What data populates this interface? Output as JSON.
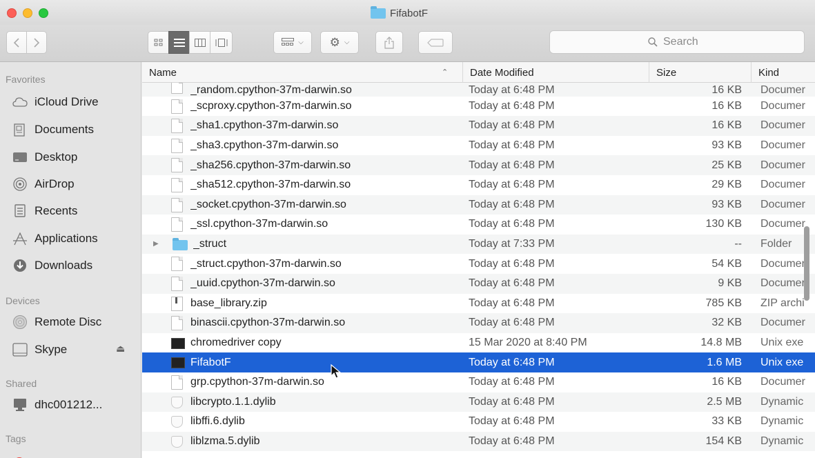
{
  "window": {
    "title": "FifabotF"
  },
  "toolbar": {
    "back_icon": "chevron-left-icon",
    "forward_icon": "chevron-right-icon",
    "view_icons": [
      "icon-view-icon",
      "list-view-icon",
      "column-view-icon",
      "gallery-view-icon"
    ],
    "active_view": "list-view-icon",
    "search_placeholder": "Search"
  },
  "sidebar": {
    "sections": {
      "favorites": "Favorites",
      "devices": "Devices",
      "shared": "Shared",
      "tags": "Tags"
    },
    "favorites": [
      {
        "label": "iCloud Drive",
        "icon": "cloud-icon"
      },
      {
        "label": "Documents",
        "icon": "documents-icon"
      },
      {
        "label": "Desktop",
        "icon": "desktop-icon"
      },
      {
        "label": "AirDrop",
        "icon": "airdrop-icon"
      },
      {
        "label": "Recents",
        "icon": "recents-icon"
      },
      {
        "label": "Applications",
        "icon": "applications-icon"
      },
      {
        "label": "Downloads",
        "icon": "downloads-icon"
      }
    ],
    "devices": [
      {
        "label": "Remote Disc",
        "icon": "disc-icon"
      },
      {
        "label": "Skype",
        "icon": "drive-icon"
      }
    ],
    "shared": [
      {
        "label": "dhc001212...",
        "icon": "computer-icon"
      }
    ]
  },
  "columns": {
    "name": "Name",
    "date": "Date Modified",
    "size": "Size",
    "kind": "Kind"
  },
  "files": [
    {
      "name": "_random.cpython-37m-darwin.so",
      "date": "Today at 6:48 PM",
      "size": "16 KB",
      "kind": "Documer",
      "icon": "doc"
    },
    {
      "name": "_scproxy.cpython-37m-darwin.so",
      "date": "Today at 6:48 PM",
      "size": "16 KB",
      "kind": "Documer",
      "icon": "doc"
    },
    {
      "name": "_sha1.cpython-37m-darwin.so",
      "date": "Today at 6:48 PM",
      "size": "16 KB",
      "kind": "Documer",
      "icon": "doc"
    },
    {
      "name": "_sha3.cpython-37m-darwin.so",
      "date": "Today at 6:48 PM",
      "size": "93 KB",
      "kind": "Documer",
      "icon": "doc"
    },
    {
      "name": "_sha256.cpython-37m-darwin.so",
      "date": "Today at 6:48 PM",
      "size": "25 KB",
      "kind": "Documer",
      "icon": "doc"
    },
    {
      "name": "_sha512.cpython-37m-darwin.so",
      "date": "Today at 6:48 PM",
      "size": "29 KB",
      "kind": "Documer",
      "icon": "doc"
    },
    {
      "name": "_socket.cpython-37m-darwin.so",
      "date": "Today at 6:48 PM",
      "size": "93 KB",
      "kind": "Documer",
      "icon": "doc"
    },
    {
      "name": "_ssl.cpython-37m-darwin.so",
      "date": "Today at 6:48 PM",
      "size": "130 KB",
      "kind": "Documer",
      "icon": "doc"
    },
    {
      "name": "_struct",
      "date": "Today at 7:33 PM",
      "size": "--",
      "kind": "Folder",
      "icon": "folder"
    },
    {
      "name": "_struct.cpython-37m-darwin.so",
      "date": "Today at 6:48 PM",
      "size": "54 KB",
      "kind": "Documer",
      "icon": "doc"
    },
    {
      "name": "_uuid.cpython-37m-darwin.so",
      "date": "Today at 6:48 PM",
      "size": "9 KB",
      "kind": "Documer",
      "icon": "doc"
    },
    {
      "name": "base_library.zip",
      "date": "Today at 6:48 PM",
      "size": "785 KB",
      "kind": "ZIP archi",
      "icon": "zip"
    },
    {
      "name": "binascii.cpython-37m-darwin.so",
      "date": "Today at 6:48 PM",
      "size": "32 KB",
      "kind": "Documer",
      "icon": "doc"
    },
    {
      "name": "chromedriver copy",
      "date": "15 Mar 2020 at 8:40 PM",
      "size": "14.8 MB",
      "kind": "Unix exe",
      "icon": "exec"
    },
    {
      "name": "FifabotF",
      "date": "Today at 6:48 PM",
      "size": "1.6 MB",
      "kind": "Unix exe",
      "icon": "exec",
      "selected": true
    },
    {
      "name": "grp.cpython-37m-darwin.so",
      "date": "Today at 6:48 PM",
      "size": "16 KB",
      "kind": "Documer",
      "icon": "doc"
    },
    {
      "name": "libcrypto.1.1.dylib",
      "date": "Today at 6:48 PM",
      "size": "2.5 MB",
      "kind": "Dynamic",
      "icon": "dylib"
    },
    {
      "name": "libffi.6.dylib",
      "date": "Today at 6:48 PM",
      "size": "33 KB",
      "kind": "Dynamic",
      "icon": "dylib"
    },
    {
      "name": "liblzma.5.dylib",
      "date": "Today at 6:48 PM",
      "size": "154 KB",
      "kind": "Dynamic",
      "icon": "dylib"
    }
  ],
  "colors": {
    "selection": "#1d62d6",
    "folder": "#72c4ee",
    "close": "#fc5f57",
    "minimize": "#fdbc2e",
    "maximize": "#28c840"
  }
}
